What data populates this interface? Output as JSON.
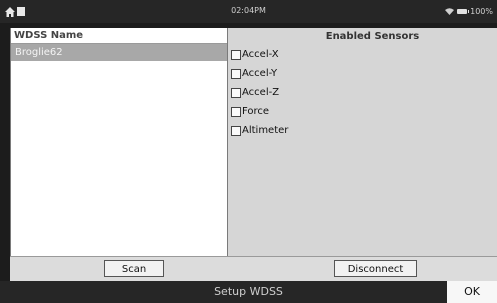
{
  "status_bar": {
    "time": "02:04PM",
    "battery": "100%",
    "icons": [
      "home-icon",
      "square-app-icon",
      "wifi-icon",
      "battery-icon"
    ]
  },
  "device_list": {
    "header": "WDSS Name",
    "items": [
      {
        "name": "Broglie62",
        "selected": true
      }
    ]
  },
  "sensors": {
    "header": "Enabled Sensors",
    "items": [
      {
        "label": "Accel-X",
        "checked": false
      },
      {
        "label": "Accel-Y",
        "checked": false
      },
      {
        "label": "Accel-Z",
        "checked": false
      },
      {
        "label": "Force",
        "checked": false
      },
      {
        "label": "Altimeter",
        "checked": false
      }
    ]
  },
  "buttons": {
    "scan": "Scan",
    "disconnect": "Disconnect"
  },
  "footer": {
    "title": "Setup WDSS",
    "ok": "OK"
  }
}
